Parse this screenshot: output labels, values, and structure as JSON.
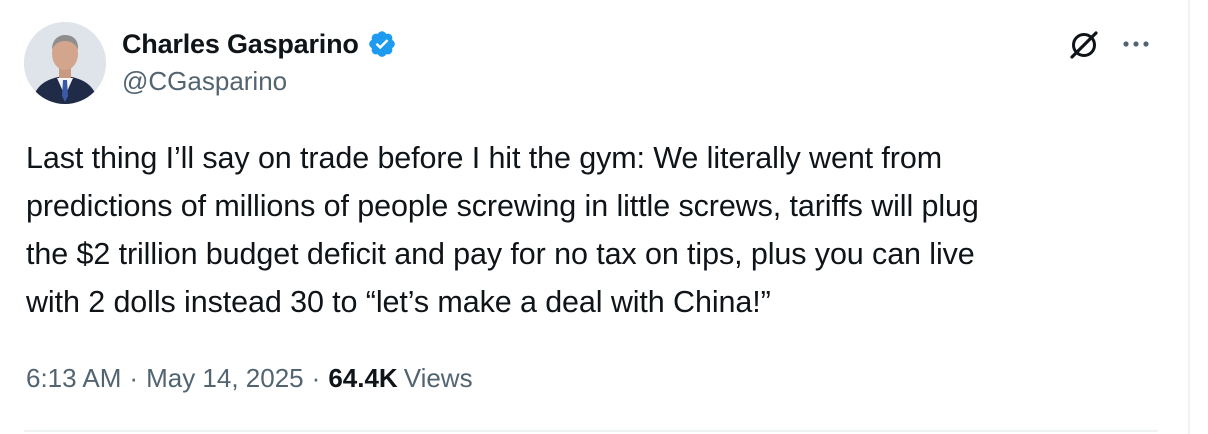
{
  "author": {
    "display_name": "Charles Gasparino",
    "handle": "@CGasparino",
    "verified": true
  },
  "icons": {
    "verified": "verified-badge-icon",
    "grok": "grok-icon",
    "more": "more-options-icon"
  },
  "tweet": {
    "lines": [
      "Last thing I’ll say on trade before I hit the gym: We literally went from",
      "predictions of millions of people screwing in little screws, tariffs will plug",
      "the $2 trillion budget deficit and pay for no tax on tips, plus you can live",
      "with 2 dolls instead 30 to “let’s make a deal with China!”"
    ]
  },
  "meta": {
    "time": "6:13 AM",
    "separator": "·",
    "date": "May 14, 2025",
    "views_count": "64.4K",
    "views_label": "Views"
  },
  "colors": {
    "text_primary": "#0f1419",
    "text_secondary": "#536471",
    "verified_blue": "#1d9bf0",
    "divider": "#eff3f4"
  }
}
